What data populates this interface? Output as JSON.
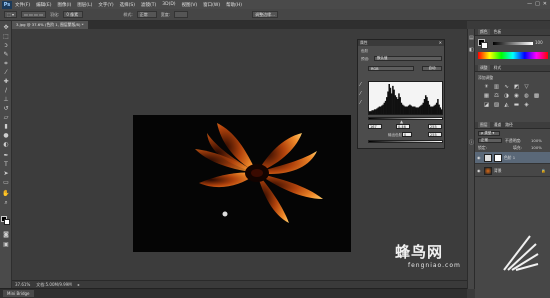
{
  "app": {
    "logo": "Ps"
  },
  "menu": [
    "文件(F)",
    "编辑(E)",
    "图像(I)",
    "图层(L)",
    "文字(Y)",
    "选择(S)",
    "滤镜(T)",
    "3D(D)",
    "视图(V)",
    "窗口(W)",
    "帮助(H)"
  ],
  "window_controls": [
    "—",
    "□",
    "✕"
  ],
  "options_bar": {
    "feather_label": "羽化:",
    "feather_value": "0 像素",
    "style_label": "样式:",
    "style_value": "正常",
    "width_label": "宽度:",
    "refine_button": "调整边缘..."
  },
  "document_tab": "3.jpg @ 37.6% (色阶 1, 图层蒙版/8) *",
  "tools": [
    "move-icon",
    "marquee-icon",
    "lasso-icon",
    "quick-select-icon",
    "crop-icon",
    "eyedropper-icon",
    "healing-icon",
    "brush-icon",
    "clone-stamp-icon",
    "history-brush-icon",
    "eraser-icon",
    "gradient-icon",
    "blur-icon",
    "dodge-icon",
    "pen-icon",
    "type-icon",
    "path-select-icon",
    "shape-icon",
    "hand-icon",
    "zoom-icon"
  ],
  "status": {
    "zoom": "37.61%",
    "doc_size": "文档:5.00M/9.99M"
  },
  "mini_bridge": {
    "tab": "Mini Bridge"
  },
  "levels": {
    "title": "属性",
    "header_label": "色阶",
    "preset_label": "预设:",
    "preset_value": "默认值",
    "channel_value": "RGB",
    "auto_button": "自动",
    "input_black": "167",
    "input_gamma": "0.46",
    "input_white": "255",
    "output_label": "输出色阶:",
    "output_black": "0",
    "output_white": "255"
  },
  "histogram_bins": [
    3,
    3,
    4,
    4,
    5,
    5,
    6,
    7,
    8,
    8,
    9,
    10,
    12,
    14,
    18,
    24,
    32,
    28,
    22,
    30,
    26,
    20,
    18,
    16,
    22,
    18,
    12,
    10,
    9,
    8,
    8,
    8,
    9,
    10,
    9,
    8,
    8,
    8,
    7,
    7,
    7,
    8,
    9,
    10,
    12,
    16,
    20,
    18,
    14,
    10,
    8,
    8,
    8,
    9,
    10,
    12,
    16,
    10,
    7,
    5
  ],
  "right_panel": {
    "color_tabs": [
      "颜色",
      "色板"
    ],
    "slider_value": "100",
    "adjust_tabs": [
      "调整",
      "样式"
    ],
    "adjust_add_label": "添加调整",
    "layer_tabs": [
      "图层",
      "通道",
      "路径"
    ],
    "blend_mode": "正常",
    "opacity_label": "不透明度:",
    "opacity_value": "100%",
    "lock_label": "锁定:",
    "fill_label": "填充:",
    "fill_value": "100%",
    "layers": [
      {
        "name": "色阶 1"
      },
      {
        "name": "背景"
      }
    ]
  },
  "watermark": {
    "cn": "蜂鸟网",
    "url": "fengniao.com"
  },
  "colors": {
    "accent": "#1b3a5a",
    "bg": "#3a3a3a",
    "flower_orange": "#d86a18"
  }
}
